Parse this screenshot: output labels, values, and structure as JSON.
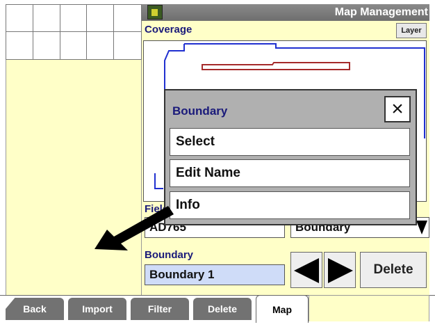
{
  "window": {
    "title": "Map Management"
  },
  "coverage": {
    "label": "Coverage",
    "layer_button": "Layer"
  },
  "field": {
    "label": "Field",
    "value": "AD765",
    "selector_value": "Boundary"
  },
  "boundary": {
    "label": "Boundary",
    "value": "Boundary 1",
    "delete_label": "Delete"
  },
  "popup": {
    "title": "Boundary",
    "close_glyph": "×",
    "items": [
      {
        "label": "Select"
      },
      {
        "label": "Edit Name"
      },
      {
        "label": "Info"
      }
    ]
  },
  "tabs": [
    {
      "label": "Back"
    },
    {
      "label": "Import"
    },
    {
      "label": "Filter"
    },
    {
      "label": "Delete"
    },
    {
      "label": "Map",
      "active": true
    }
  ],
  "colors": {
    "panel_bg": "#ffffc8",
    "title_bar": "#7a7a7a",
    "label_text": "#1a1a7a",
    "map_outline": "#2030d0",
    "map_strip": "#a52a2a",
    "selected_field_bg": "#cfdcf8",
    "tab_bg": "#727272"
  }
}
